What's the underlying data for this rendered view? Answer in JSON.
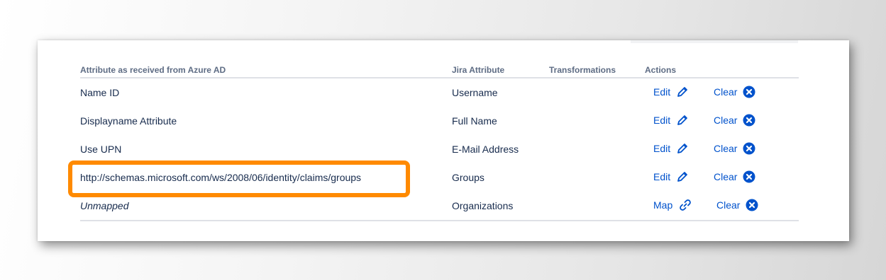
{
  "table": {
    "headers": {
      "attribute": "Attribute as received from Azure AD",
      "jira": "Jira Attribute",
      "transformations": "Transformations",
      "actions": "Actions"
    },
    "rows": [
      {
        "attribute": "Name ID",
        "jira": "Username",
        "primary_action": "Edit",
        "primary_icon": "pencil-icon",
        "clear": "Clear"
      },
      {
        "attribute": "Displayname Attribute",
        "jira": "Full Name",
        "primary_action": "Edit",
        "primary_icon": "pencil-icon",
        "clear": "Clear"
      },
      {
        "attribute": "Use UPN",
        "jira": "E-Mail Address",
        "primary_action": "Edit",
        "primary_icon": "pencil-icon",
        "clear": "Clear"
      },
      {
        "attribute": "http://schemas.microsoft.com/ws/2008/06/identity/claims/groups",
        "jira": "Groups",
        "primary_action": "Edit",
        "primary_icon": "pencil-icon",
        "clear": "Clear",
        "highlighted": true
      },
      {
        "attribute": "Unmapped",
        "attribute_italic": true,
        "jira": "Organizations",
        "primary_action": "Map",
        "primary_icon": "link-icon",
        "clear": "Clear"
      }
    ]
  },
  "colors": {
    "link": "#0052cc",
    "text": "#172b4d",
    "header_text": "#5e6c84",
    "highlight": "#ff8a00",
    "divider": "#dfe1e6"
  }
}
